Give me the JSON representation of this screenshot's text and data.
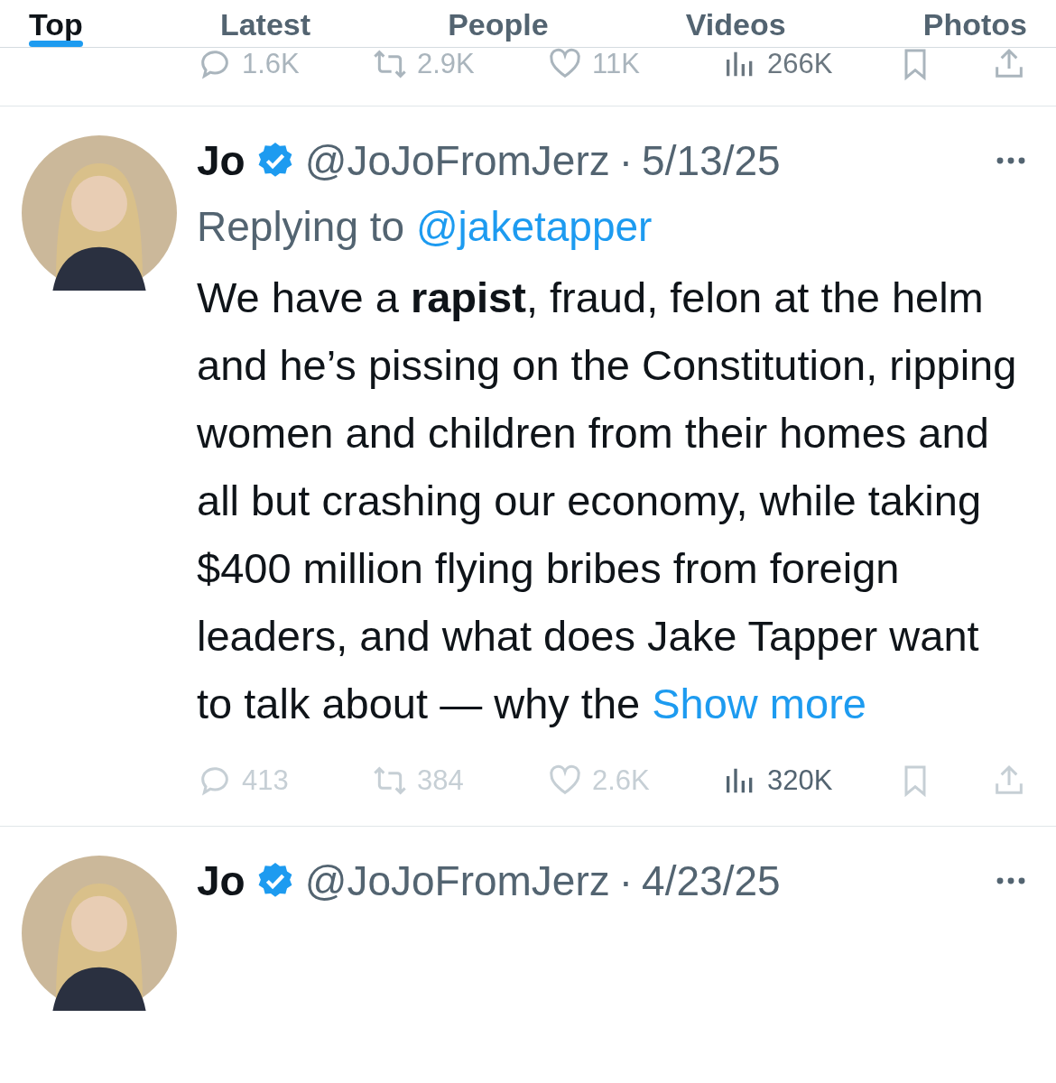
{
  "tabs": [
    {
      "label": "Top",
      "selected": true
    },
    {
      "label": "Latest",
      "selected": false
    },
    {
      "label": "People",
      "selected": false
    },
    {
      "label": "Videos",
      "selected": false
    },
    {
      "label": "Photos",
      "selected": false
    }
  ],
  "tweets": [
    {
      "kind": "stats_only",
      "stats": {
        "replies": "1.6K",
        "reposts": "2.9K",
        "likes": "11K",
        "views": "266K"
      }
    },
    {
      "kind": "full",
      "name": "Jo",
      "verified": true,
      "handle": "@JoJoFromJerz",
      "separator": "·",
      "date": "5/13/25",
      "reply_label": "Replying to",
      "reply_to": "@jaketapper",
      "body": "We have a **rapist**, fraud, felon at the helm and he’s pissing on the Constitution, ripping women and children from their homes and all but crashing our economy, while taking $400 million flying bribes from foreign leaders, and what does Jake Tapper want to talk about — why the",
      "show_more": "Show more",
      "stats": {
        "replies": "413",
        "reposts": "384",
        "likes": "2.6K",
        "views": "320K"
      }
    },
    {
      "kind": "header_only",
      "name": "Jo",
      "verified": true,
      "handle": "@JoJoFromJerz",
      "separator": "·",
      "date": "4/23/25"
    }
  ]
}
